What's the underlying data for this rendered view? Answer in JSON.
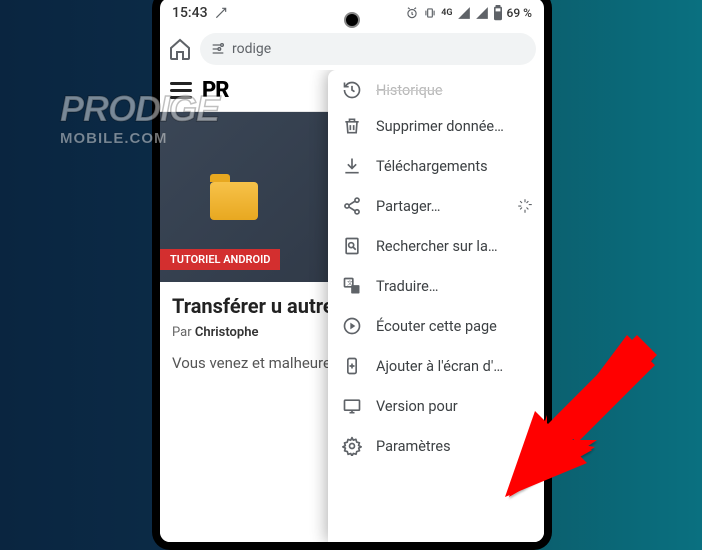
{
  "status": {
    "time": "15:43",
    "battery": "69 %"
  },
  "browser": {
    "url_visible": "rodige",
    "home_name": "home"
  },
  "page": {
    "site_logo": "PR",
    "category": "TUTORIEL ANDROID",
    "title": "Transférer u\nautre smart",
    "byline_prefix": "Par ",
    "byline_author": "Christophe",
    "body": "Vous venez\net malheureu"
  },
  "watermark": {
    "line1": "PRODIGE",
    "line2": "MOBILE.COM"
  },
  "menu": {
    "items": [
      {
        "icon": "history",
        "label": "Historique"
      },
      {
        "icon": "trash",
        "label": "Supprimer donnée…"
      },
      {
        "icon": "download",
        "label": "Téléchargements"
      },
      {
        "icon": "share",
        "label": "Partager…",
        "trailing": "star"
      },
      {
        "icon": "search",
        "label": "Rechercher sur la…"
      },
      {
        "icon": "translate",
        "label": "Traduire…"
      },
      {
        "icon": "listen",
        "label": "Écouter cette page"
      },
      {
        "icon": "addhome",
        "label": "Ajouter à l'écran d'…"
      },
      {
        "icon": "desktop",
        "label": "Version pour"
      },
      {
        "icon": "settings",
        "label": "Paramètres"
      }
    ]
  }
}
